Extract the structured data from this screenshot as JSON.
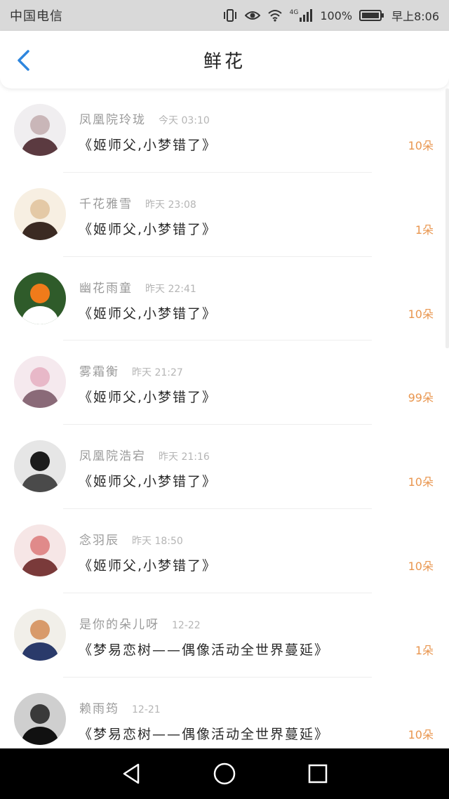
{
  "status_bar": {
    "carrier": "中国电信",
    "network": "4G",
    "battery": "100%",
    "time": "早上8:06"
  },
  "header": {
    "title": "鲜花",
    "back_icon": "chevron-left-icon"
  },
  "colors": {
    "accent": "#2e86de",
    "count": "#e9964f",
    "status_bar_bg": "#d9d9d9",
    "nav_bg": "#000000"
  },
  "rows": [
    {
      "name": "凤凰院玲珑",
      "time": "今天 03:10",
      "message": "《姬师父,小梦错了》",
      "count": "10朵",
      "avatar": "avatar-icon"
    },
    {
      "name": "千花雅雪",
      "time": "昨天 23:08",
      "message": "《姬师父,小梦错了》",
      "count": "1朵",
      "avatar": "avatar-icon"
    },
    {
      "name": "幽花雨童",
      "time": "昨天 22:41",
      "message": "《姬师父,小梦错了》",
      "count": "10朵",
      "avatar": "avatar-icon"
    },
    {
      "name": "雾霜衡",
      "time": "昨天 21:27",
      "message": "《姬师父,小梦错了》",
      "count": "99朵",
      "avatar": "avatar-icon"
    },
    {
      "name": "凤凰院浩宕",
      "time": "昨天 21:16",
      "message": "《姬师父,小梦错了》",
      "count": "10朵",
      "avatar": "avatar-icon"
    },
    {
      "name": "念羽辰",
      "time": "昨天 18:50",
      "message": "《姬师父,小梦错了》",
      "count": "10朵",
      "avatar": "avatar-icon"
    },
    {
      "name": "是你的朵儿呀",
      "time": "12-22",
      "message": "《梦易恋树——偶像活动全世界蔓延》",
      "count": "1朵",
      "avatar": "avatar-icon"
    },
    {
      "name": "赖雨筠",
      "time": "12-21",
      "message": "《梦易恋树——偶像活动全世界蔓延》",
      "count": "10朵",
      "avatar": "avatar-icon"
    }
  ],
  "system_nav": {
    "back": "triangle-back-icon",
    "home": "circle-home-icon",
    "recents": "square-recents-icon"
  }
}
